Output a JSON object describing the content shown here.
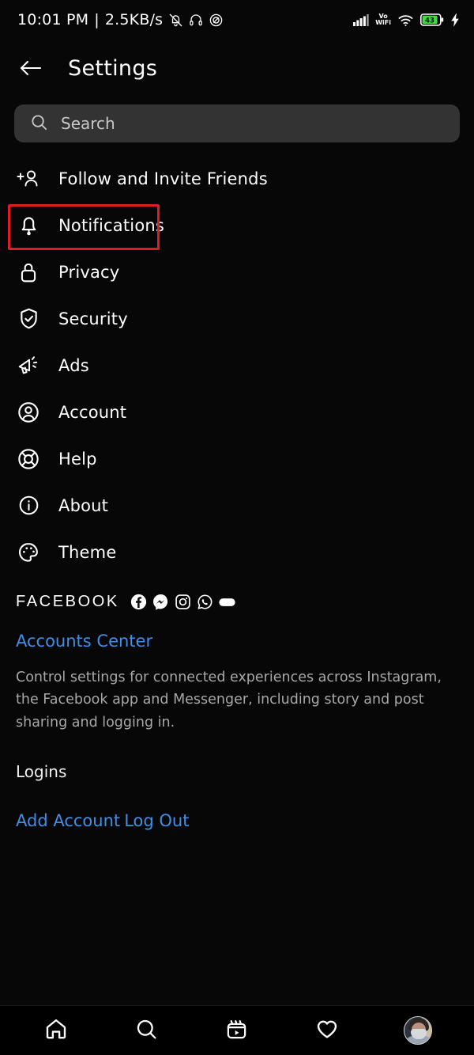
{
  "statusbar": {
    "time": "10:01 PM",
    "separator": "|",
    "network_speed": "2.5KB/s",
    "left_icons": [
      "bell-muted-icon",
      "headphones-icon",
      "dnd-circle-slash-icon"
    ],
    "volte_line1": "Vo",
    "volte_line2": "WiFi",
    "right_icons": [
      "cellular-signal-icon",
      "volte-wifi-icon",
      "wifi-icon",
      "battery-icon",
      "charging-bolt-icon"
    ],
    "battery_level": "43"
  },
  "header": {
    "back_icon": "arrow-left-icon",
    "title": "Settings"
  },
  "search": {
    "icon": "search-icon",
    "placeholder": "Search",
    "value": ""
  },
  "menu": {
    "items": [
      {
        "label": "Follow and Invite Friends",
        "icon": "person-plus-icon",
        "highlighted": false
      },
      {
        "label": "Notifications",
        "icon": "bell-icon",
        "highlighted": true
      },
      {
        "label": "Privacy",
        "icon": "lock-icon",
        "highlighted": false
      },
      {
        "label": "Security",
        "icon": "shield-check-icon",
        "highlighted": false
      },
      {
        "label": "Ads",
        "icon": "megaphone-icon",
        "highlighted": false
      },
      {
        "label": "Account",
        "icon": "person-circle-icon",
        "highlighted": false
      },
      {
        "label": "Help",
        "icon": "life-ring-icon",
        "highlighted": false
      },
      {
        "label": "About",
        "icon": "info-circle-icon",
        "highlighted": false
      },
      {
        "label": "Theme",
        "icon": "palette-icon",
        "highlighted": false
      }
    ],
    "highlight_color": "#e01b24"
  },
  "facebook_section": {
    "word": "FACEBOOK",
    "brand_icons": [
      "facebook-icon",
      "messenger-icon",
      "instagram-icon",
      "whatsapp-icon",
      "meta-oval-icon"
    ],
    "accounts_center_label": "Accounts Center",
    "description": "Control settings for connected experiences across Instagram, the Facebook app and Messenger, including story and post sharing and logging in.",
    "logins_label": "Logins",
    "add_account_label": "Add Account",
    "log_out_label": "Log Out",
    "link_color": "#3f8ee8"
  },
  "bottom_nav": {
    "items": [
      {
        "icon": "home-icon",
        "name": "nav-home"
      },
      {
        "icon": "search-icon",
        "name": "nav-search"
      },
      {
        "icon": "reels-icon",
        "name": "nav-reels"
      },
      {
        "icon": "heart-icon",
        "name": "nav-activity"
      },
      {
        "icon": "avatar-icon",
        "name": "nav-profile"
      }
    ]
  }
}
